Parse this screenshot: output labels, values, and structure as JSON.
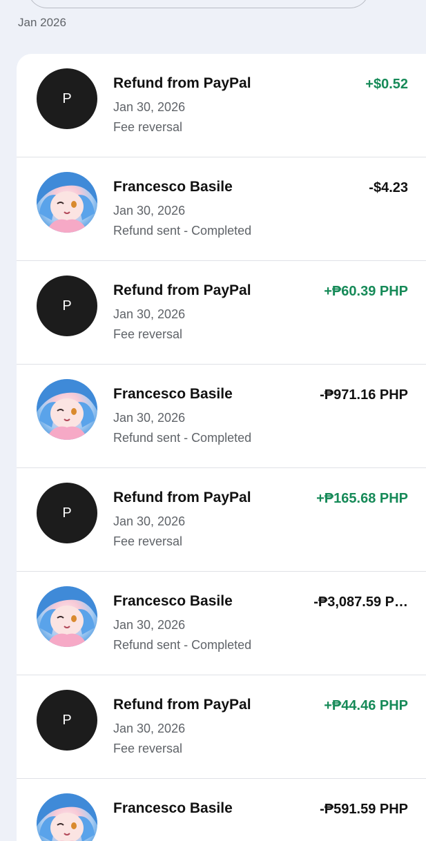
{
  "month_label": "Jan 2026",
  "transactions": [
    {
      "avatar_type": "initial",
      "initial": "P",
      "name": "Refund from PayPal",
      "date": "Jan 30, 2026",
      "description": "Fee reversal",
      "amount": "+$0.52",
      "direction": "positive"
    },
    {
      "avatar_type": "photo",
      "initial": "",
      "name": "Francesco Basile",
      "date": "Jan 30, 2026",
      "description": "Refund sent - Completed",
      "amount": "-$4.23",
      "direction": "negative"
    },
    {
      "avatar_type": "initial",
      "initial": "P",
      "name": "Refund from PayPal",
      "date": "Jan 30, 2026",
      "description": "Fee reversal",
      "amount": "+₱60.39 PHP",
      "direction": "positive"
    },
    {
      "avatar_type": "photo",
      "initial": "",
      "name": "Francesco Basile",
      "date": "Jan 30, 2026",
      "description": "Refund sent - Completed",
      "amount": "-₱971.16 PHP",
      "direction": "negative"
    },
    {
      "avatar_type": "initial",
      "initial": "P",
      "name": "Refund from PayPal",
      "date": "Jan 30, 2026",
      "description": "Fee reversal",
      "amount": "+₱165.68 PHP",
      "direction": "positive"
    },
    {
      "avatar_type": "photo",
      "initial": "",
      "name": "Francesco Basile",
      "date": "Jan 30, 2026",
      "description": "Refund sent - Completed",
      "amount": "-₱3,087.59 P…",
      "direction": "negative"
    },
    {
      "avatar_type": "initial",
      "initial": "P",
      "name": "Refund from PayPal",
      "date": "Jan 30, 2026",
      "description": "Fee reversal",
      "amount": "+₱44.46 PHP",
      "direction": "positive"
    },
    {
      "avatar_type": "photo",
      "initial": "",
      "name": "Francesco Basile",
      "date": "",
      "description": "",
      "amount": "-₱591.59 PHP",
      "direction": "negative"
    }
  ],
  "colors": {
    "positive": "#168a58",
    "negative": "#111111",
    "background": "#eef1f8",
    "initial_avatar": "#1c1c1c"
  }
}
